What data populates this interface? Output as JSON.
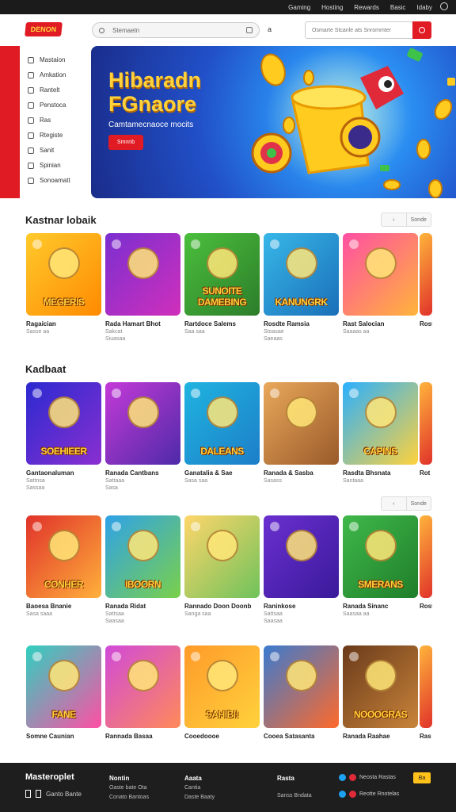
{
  "topbar": {
    "links": [
      "Gaming",
      "Hosting",
      "Rewards",
      "Basic",
      "Idaby"
    ]
  },
  "header": {
    "logo_text": "DENON",
    "search_placeholder": "Stemaetn",
    "separator": "a",
    "search2_placeholder": "Osmarte Stcanle ats Snrommter"
  },
  "sidebar": {
    "items": [
      "Mastaion",
      "Amkation",
      "Rantelt",
      "Penstoca",
      "Ras",
      "Rtegiste",
      "Sanit",
      "Spinian",
      "Sonoamatt"
    ]
  },
  "hero": {
    "title": "Hibaradn FGnaore",
    "subtitle": "Camtamecnaoce mocits",
    "button": "Smnnb"
  },
  "section1": {
    "title": "Kastnar lobaik",
    "pager": [
      "‹",
      "Sonde"
    ]
  },
  "section2": {
    "title": "Kadbaat"
  },
  "section3": {
    "pager": [
      "‹",
      "Sonde"
    ]
  },
  "rows": [
    [
      {
        "art": "MEGERIS",
        "name": "Ragaician",
        "meta": [
          "Sasse aa"
        ],
        "colors": [
          "#ffca2c",
          "#ff8a00"
        ]
      },
      {
        "art": "",
        "name": "Rada Hamart Bhot",
        "meta": [
          "Sakcat",
          "Siuasaa"
        ],
        "colors": [
          "#7a2fd0",
          "#d02fbb"
        ]
      },
      {
        "art": "SUNOITE DAMEBING",
        "name": "Rartdoce Salems",
        "meta": [
          "Saa saa"
        ],
        "colors": [
          "#4bbf3c",
          "#2c7d2a"
        ]
      },
      {
        "art": "KANUNGRK",
        "name": "Rosdte Ramsia",
        "meta": [
          "Stoasae",
          "Saeaas"
        ],
        "colors": [
          "#37b7e8",
          "#1a6fb8"
        ]
      },
      {
        "art": "",
        "name": "Rast Salocian",
        "meta": [
          "Saaaas aa"
        ],
        "colors": [
          "#ff4fa3",
          "#ffb43b"
        ]
      }
    ],
    [
      {
        "art": "SOEHIEER",
        "name": "Gantaonaluman",
        "meta": [
          "Sattnsa",
          "Sassaa"
        ],
        "colors": [
          "#2a2ad0",
          "#8a2fd0"
        ]
      },
      {
        "art": "",
        "name": "Ranada Cantbans",
        "meta": [
          "Sattaaa",
          "Sasa"
        ],
        "colors": [
          "#c43ad8",
          "#4e2aa8"
        ]
      },
      {
        "art": "DALEANS",
        "name": "Ganatalia & Sae",
        "meta": [
          "Sasa saa"
        ],
        "colors": [
          "#1fb4e0",
          "#1d7ec8"
        ]
      },
      {
        "art": "",
        "name": "Ranada & Sasba",
        "meta": [
          "Sasass"
        ],
        "colors": [
          "#e9a85a",
          "#9a5a2a"
        ]
      },
      {
        "art": "CAPINS",
        "name": "Rasdta Bhsnata",
        "meta": [
          "Santaaa"
        ],
        "colors": [
          "#2ab0ff",
          "#ffd23c"
        ]
      }
    ],
    [
      {
        "art": "CONHER",
        "name": "Baoesa Bnanie",
        "meta": [
          "Sasa saaa"
        ],
        "colors": [
          "#e0322a",
          "#ffb03b"
        ]
      },
      {
        "art": "IBOORN",
        "name": "Ranada Ridat",
        "meta": [
          "Sattsaa",
          "Saasaa"
        ],
        "colors": [
          "#2fa2e8",
          "#7ad04a"
        ]
      },
      {
        "art": "",
        "name": "Rannado Doon Doonb",
        "meta": [
          "Sanga saa"
        ],
        "colors": [
          "#ffd66a",
          "#6fc25b"
        ]
      },
      {
        "art": "",
        "name": "Raninkose",
        "meta": [
          "Sattsaa",
          "Saasaa"
        ],
        "colors": [
          "#6a2fd0",
          "#3a1a9a"
        ]
      },
      {
        "art": "SMERANS",
        "name": "Ranada Sinanc",
        "meta": [
          "Saasaa aa"
        ],
        "colors": [
          "#3fb84a",
          "#1f7e2a"
        ]
      }
    ],
    [
      {
        "art": "FANE",
        "name": "Somne Caunian",
        "meta": [],
        "colors": [
          "#2fd0c0",
          "#ff4fa3"
        ]
      },
      {
        "art": "",
        "name": "Rannada Basaa",
        "meta": [],
        "colors": [
          "#d04ad8",
          "#ff8a5a"
        ]
      },
      {
        "art": "SAHIBI!",
        "name": "Cooedoooe",
        "meta": [],
        "colors": [
          "#ff9a2a",
          "#ffd23c"
        ]
      },
      {
        "art": "",
        "name": "Cooea Satasanta",
        "meta": [],
        "colors": [
          "#3a7ad0",
          "#ff6a2a"
        ]
      },
      {
        "art": "NOOOGRAS",
        "name": "Ranada Raahae",
        "meta": [],
        "colors": [
          "#6a3a1a",
          "#c8843a"
        ]
      }
    ]
  ],
  "row_edge_labels": [
    "Rost",
    "Rot",
    "Rost",
    "Ras"
  ],
  "footer": {
    "brand": "Masteroplet",
    "brand_sub": "Ganto Bante",
    "cols": [
      {
        "h": "Nontin",
        "items": [
          "Oaste bate Ota",
          "Conato Bantoas"
        ]
      },
      {
        "h": "Aaata",
        "items": [
          "Cantia",
          "Daste Baaty"
        ]
      },
      {
        "h": "Rasta",
        "items": [
          "Sanss Bndata"
        ]
      }
    ],
    "social": [
      "Neosta Rastas",
      "Reotte Rnotelas"
    ],
    "btn": "Ba"
  }
}
